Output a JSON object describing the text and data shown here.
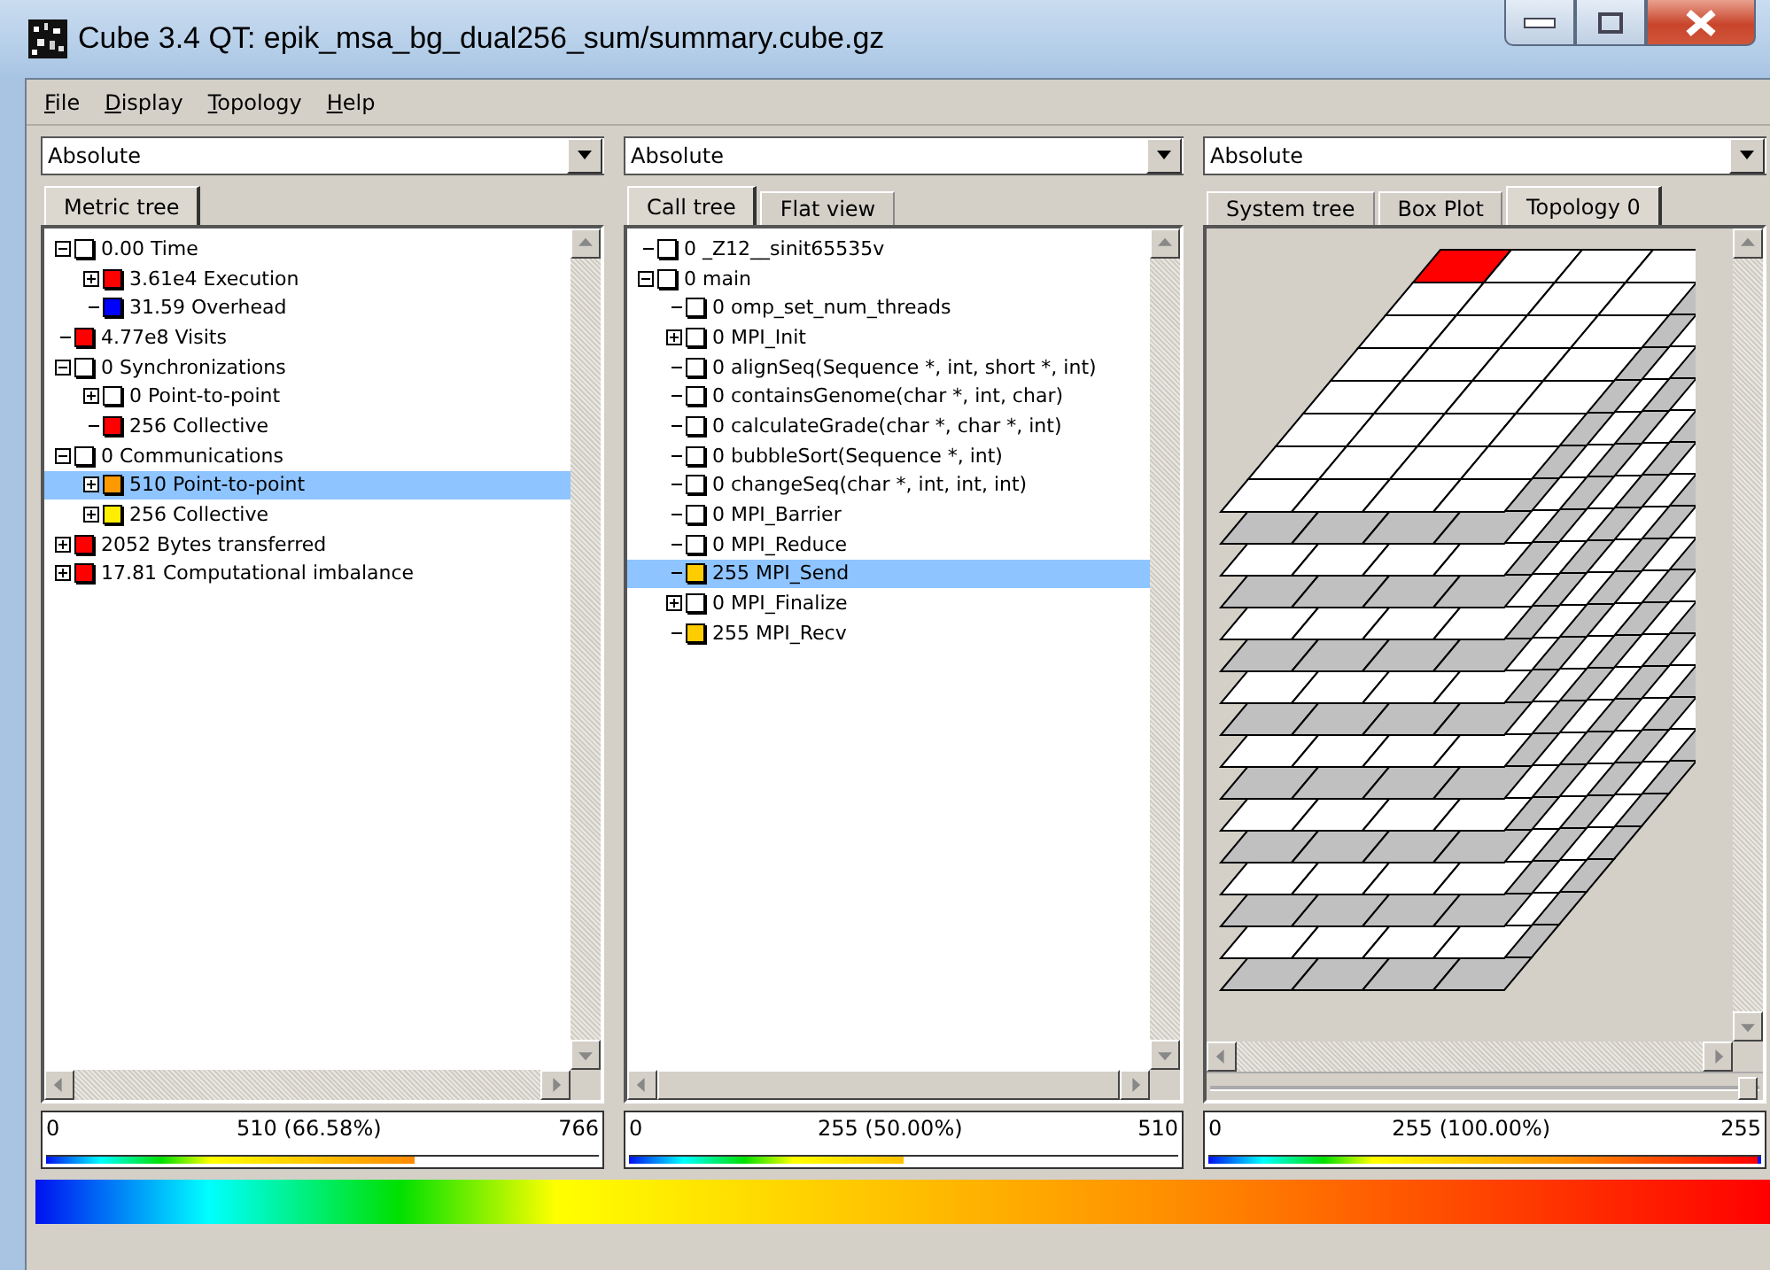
{
  "window": {
    "title": "Cube 3.4 QT: epik_msa_bg_dual256_sum/summary.cube.gz"
  },
  "menu": [
    {
      "label": "File"
    },
    {
      "label": "Display"
    },
    {
      "label": "Topology"
    },
    {
      "label": "Help"
    }
  ],
  "panels": [
    {
      "mode": "Absolute",
      "tabs": [
        {
          "label": "Metric tree",
          "selected": true
        }
      ],
      "view": {
        "kind": "tree",
        "items": [
          {
            "label": "0.00 Time",
            "color": "#ffffff",
            "kind": "branch",
            "expanded": true,
            "selected": false,
            "children": [
              {
                "label": "3.61e4 Execution",
                "color": "#ff0000",
                "kind": "branch",
                "expanded": false,
                "selected": false
              },
              {
                "label": "31.59 Overhead",
                "color": "#0000ff",
                "kind": "leaf",
                "selected": false
              }
            ]
          },
          {
            "label": "4.77e8 Visits",
            "color": "#ff0000",
            "kind": "leaf",
            "selected": false
          },
          {
            "label": "0 Synchronizations",
            "color": "#ffffff",
            "kind": "branch",
            "expanded": true,
            "selected": false,
            "children": [
              {
                "label": "0 Point-to-point",
                "color": "#ffffff",
                "kind": "branch",
                "expanded": false,
                "selected": false
              },
              {
                "label": "256 Collective",
                "color": "#ff0000",
                "kind": "leaf",
                "selected": false
              }
            ]
          },
          {
            "label": "0 Communications",
            "color": "#ffffff",
            "kind": "branch",
            "expanded": true,
            "selected": false,
            "children": [
              {
                "label": "510 Point-to-point",
                "color": "#ff9900",
                "kind": "branch",
                "expanded": false,
                "selected": true
              },
              {
                "label": "256 Collective",
                "color": "#ffee00",
                "kind": "branch",
                "expanded": false,
                "selected": false
              }
            ]
          },
          {
            "label": "2052 Bytes transferred",
            "color": "#ff0000",
            "kind": "branch",
            "expanded": false,
            "selected": false
          },
          {
            "label": "17.81 Computational imbalance",
            "color": "#ff0000",
            "kind": "branch",
            "expanded": false,
            "selected": false
          }
        ]
      },
      "scale": {
        "min": "0",
        "value": "510 (66.58%)",
        "max": "766",
        "level": 0.6658
      }
    },
    {
      "mode": "Absolute",
      "tabs": [
        {
          "label": "Call tree",
          "selected": true
        },
        {
          "label": "Flat view",
          "selected": false
        }
      ],
      "view": {
        "kind": "tree",
        "items": [
          {
            "label": "0 _Z12__sinit65535v",
            "color": "#ffffff",
            "kind": "leaf",
            "selected": false
          },
          {
            "label": "0 main",
            "color": "#ffffff",
            "kind": "branch",
            "expanded": true,
            "selected": false,
            "children": [
              {
                "label": "0 omp_set_num_threads",
                "color": "#ffffff",
                "kind": "leaf",
                "selected": false
              },
              {
                "label": "0 MPI_Init",
                "color": "#ffffff",
                "kind": "branch",
                "expanded": false,
                "selected": false
              },
              {
                "label": "0 alignSeq(Sequence *, int, short *, int)",
                "color": "#ffffff",
                "kind": "leaf",
                "selected": false
              },
              {
                "label": "0 containsGenome(char *, int, char)",
                "color": "#ffffff",
                "kind": "leaf",
                "selected": false
              },
              {
                "label": "0 calculateGrade(char *, char *, int)",
                "color": "#ffffff",
                "kind": "leaf",
                "selected": false
              },
              {
                "label": "0 bubbleSort(Sequence *, int)",
                "color": "#ffffff",
                "kind": "leaf",
                "selected": false
              },
              {
                "label": "0 changeSeq(char *, int, int, int)",
                "color": "#ffffff",
                "kind": "leaf",
                "selected": false
              },
              {
                "label": "0 MPI_Barrier",
                "color": "#ffffff",
                "kind": "leaf",
                "selected": false
              },
              {
                "label": "0 MPI_Reduce",
                "color": "#ffffff",
                "kind": "leaf",
                "selected": false
              },
              {
                "label": "255 MPI_Send",
                "color": "#ffcc00",
                "kind": "leaf",
                "selected": true
              },
              {
                "label": "0 MPI_Finalize",
                "color": "#ffffff",
                "kind": "branch",
                "expanded": false,
                "selected": false
              },
              {
                "label": "255 MPI_Recv",
                "color": "#ffcc00",
                "kind": "leaf",
                "selected": false
              }
            ]
          }
        ]
      },
      "scale": {
        "min": "0",
        "value": "255 (50.00%)",
        "max": "510",
        "level": 0.5
      }
    },
    {
      "mode": "Absolute",
      "tabs": [
        {
          "label": "System tree",
          "selected": false
        },
        {
          "label": "Box Plot",
          "selected": false
        },
        {
          "label": "Topology 0",
          "selected": true
        }
      ],
      "view": {
        "kind": "topology",
        "zoom_slider": {
          "level": 0.97
        }
      },
      "scale": {
        "min": "0",
        "value": "255 (100.00%)",
        "max": "255",
        "level": 1.0
      }
    }
  ]
}
